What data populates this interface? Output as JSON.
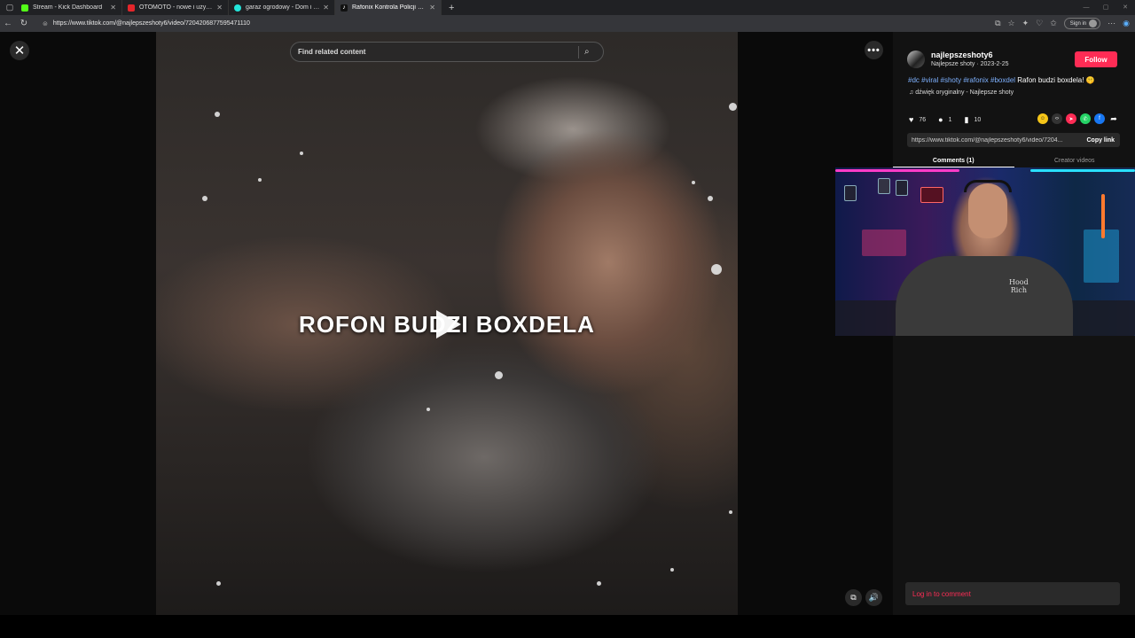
{
  "browser": {
    "tabs": [
      {
        "title": "Stream - Kick Dashboard",
        "favicon_color": "#53fc18",
        "active": false
      },
      {
        "title": "OTOMOTO - nowe i używane sam",
        "favicon_color": "#e4262b",
        "active": false
      },
      {
        "title": "garaz ogrodowy - Dom i Ogród -",
        "favicon_color": "#23e5db",
        "active": false
      },
      {
        "title": "Rafonix Kontrola Policji Cale Nagr",
        "favicon_color": "#ffffff",
        "active": true
      }
    ],
    "new_tab_symbol": "+",
    "url": "https://www.tiktok.com/@najlepszeshoty6/video/7204206877595471110",
    "sign_in_label": "Sign in"
  },
  "video": {
    "search_placeholder": "Find related content",
    "overlay_text": "ROFON BUDZI BOXDELA"
  },
  "post": {
    "username": "najlepszeshoty6",
    "meta": "Najlepsze shoty · 2023-2-25",
    "follow_label": "Follow",
    "hashtags": [
      "#dc",
      "#viral",
      "#shoty",
      "#rafonix",
      "#boxdel"
    ],
    "caption_text": "Rafon budzi boxdela! 🤫",
    "sound": "♫  dźwięk oryginalny - Najlepsze shoty",
    "likes": "76",
    "comments": "1",
    "saves": "10",
    "link": "https://www.tiktok.com/@najlepszeshoty6/video/7204...",
    "copy_label": "Copy link",
    "tabs": [
      "Comments (1)",
      "Creator videos"
    ],
    "login_prompt": "Log in to comment"
  },
  "webcam": {
    "shirt_text": "Hood\nRich"
  },
  "colors": {
    "accent": "#fe2c55",
    "hashtag": "#7eb1ff",
    "background": "#121212"
  }
}
